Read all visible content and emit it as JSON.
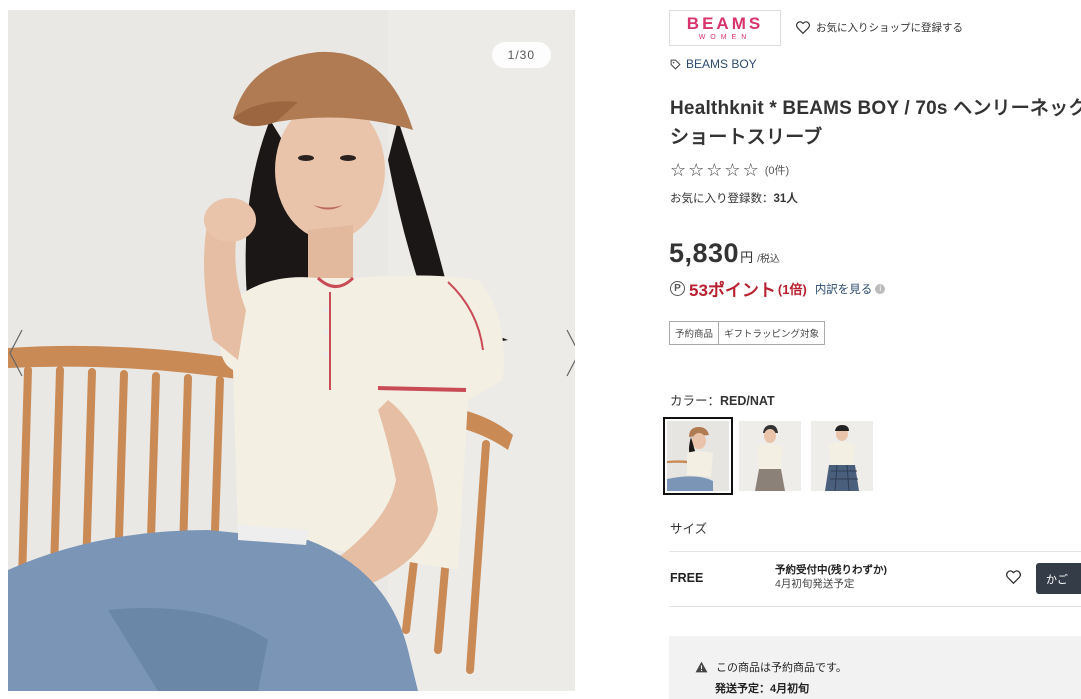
{
  "gallery": {
    "counter": "1/30",
    "prev_icon": "chevron-left-icon",
    "next_icon": "chevron-right-icon"
  },
  "shop": {
    "logo_main": "BEAMS",
    "logo_sub": "WOMEN",
    "logo_color": "#d9336b",
    "favorite_shop_label": "お気に入りショップに登録する"
  },
  "product": {
    "brand": "BEAMS BOY",
    "title": "Healthknit * BEAMS BOY / 70s ヘンリーネック ショートスリーブ",
    "review_count": "(0件)",
    "favorite_label": "お気に入り登録数：",
    "favorite_count": "31人",
    "price": "5,830",
    "price_unit": "円",
    "price_tax": "/税込",
    "points": "53ポイント",
    "points_multiplier": "(1倍)",
    "points_link": "内訳を見る",
    "points_color": "#b8202f",
    "badges": [
      "予約商品",
      "ギフトラッピング対象"
    ]
  },
  "color": {
    "label": "カラー：",
    "selected": "RED/NAT"
  },
  "size": {
    "label": "サイズ",
    "rows": [
      {
        "size": "FREE",
        "status": "予約受付中(残りわずか)",
        "ship": "4月初旬発送予定",
        "cart_label": "かご"
      }
    ]
  },
  "notice": {
    "line1": "この商品は予約商品です。",
    "line2": "発送予定：4月初旬"
  }
}
